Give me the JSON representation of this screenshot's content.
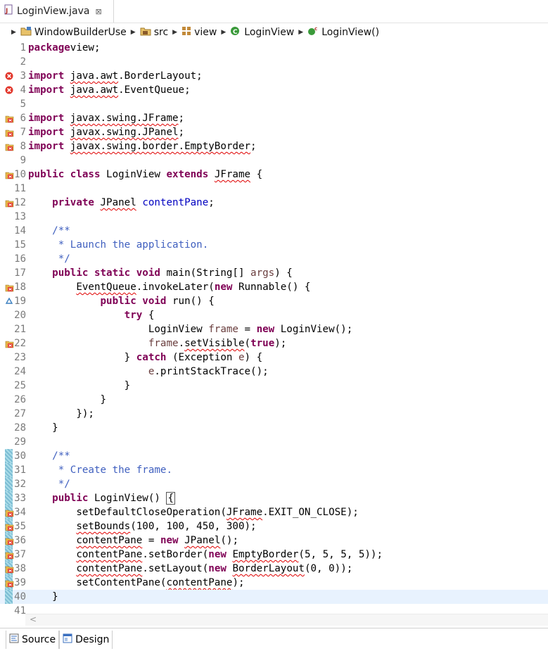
{
  "tab": {
    "file_name": "LoginView.java",
    "close_glyph": "⊠"
  },
  "breadcrumb": [
    {
      "label": "WindowBuilderUse",
      "icon": "project-icon"
    },
    {
      "label": "src",
      "icon": "source-folder-icon"
    },
    {
      "label": "view",
      "icon": "package-icon"
    },
    {
      "label": "LoginView",
      "icon": "class-icon"
    },
    {
      "label": "LoginView()",
      "icon": "constructor-icon"
    }
  ],
  "editor": {
    "lines": [
      {
        "n": "1",
        "marker": "",
        "code": [
          [
            "kw",
            "package"
          ],
          [
            "",
            "view;"
          ]
        ]
      },
      {
        "n": "2",
        "marker": "",
        "code": []
      },
      {
        "n": "3",
        "marker": "error",
        "code": [
          [
            "kw",
            "import"
          ],
          [
            "",
            " "
          ],
          [
            "err",
            "java.awt"
          ],
          [
            "",
            ".BorderLayout;"
          ]
        ]
      },
      {
        "n": "4",
        "marker": "error",
        "code": [
          [
            "kw",
            "import"
          ],
          [
            "",
            " "
          ],
          [
            "err",
            "java.awt"
          ],
          [
            "",
            ".EventQueue;"
          ]
        ]
      },
      {
        "n": "5",
        "marker": "",
        "code": []
      },
      {
        "n": "6",
        "marker": "fix",
        "code": [
          [
            "kw",
            "import"
          ],
          [
            "",
            " "
          ],
          [
            "err",
            "javax.swing.JFrame"
          ],
          [
            "",
            ";"
          ]
        ]
      },
      {
        "n": "7",
        "marker": "fix",
        "code": [
          [
            "kw",
            "import"
          ],
          [
            "",
            " "
          ],
          [
            "err",
            "javax.swing.JPanel"
          ],
          [
            "",
            ";"
          ]
        ]
      },
      {
        "n": "8",
        "marker": "fix",
        "code": [
          [
            "kw",
            "import"
          ],
          [
            "",
            " "
          ],
          [
            "err",
            "javax.swing.border.EmptyBorder"
          ],
          [
            "",
            ";"
          ]
        ]
      },
      {
        "n": "9",
        "marker": "",
        "code": []
      },
      {
        "n": "10",
        "marker": "fix",
        "code": [
          [
            "kw",
            "public class"
          ],
          [
            "",
            " LoginView "
          ],
          [
            "kw",
            "extends"
          ],
          [
            "",
            " "
          ],
          [
            "err",
            "JFrame"
          ],
          [
            "",
            " {"
          ]
        ]
      },
      {
        "n": "11",
        "marker": "",
        "code": []
      },
      {
        "n": "12",
        "marker": "fix",
        "code": [
          [
            "",
            "    "
          ],
          [
            "kw",
            "private"
          ],
          [
            "",
            " "
          ],
          [
            "err",
            "JPanel"
          ],
          [
            "",
            " "
          ],
          [
            "fld",
            "contentPane"
          ],
          [
            "",
            ";"
          ]
        ]
      },
      {
        "n": "13",
        "marker": "",
        "code": []
      },
      {
        "n": "14",
        "marker": "",
        "code": [
          [
            "cm",
            "    /**"
          ]
        ]
      },
      {
        "n": "15",
        "marker": "",
        "code": [
          [
            "cm",
            "     * Launch the application."
          ]
        ]
      },
      {
        "n": "16",
        "marker": "",
        "code": [
          [
            "cm",
            "     */"
          ]
        ]
      },
      {
        "n": "17",
        "marker": "",
        "code": [
          [
            "",
            "    "
          ],
          [
            "kw",
            "public static void"
          ],
          [
            "",
            " main(String[] "
          ],
          [
            "prm",
            "args"
          ],
          [
            "",
            ") {"
          ]
        ]
      },
      {
        "n": "18",
        "marker": "fix",
        "code": [
          [
            "",
            "        "
          ],
          [
            "err",
            "EventQueue"
          ],
          [
            "",
            ".invokeLater("
          ],
          [
            "kw",
            "new"
          ],
          [
            "",
            " Runnable() {"
          ]
        ]
      },
      {
        "n": "19",
        "marker": "override",
        "code": [
          [
            "",
            "            "
          ],
          [
            "kw",
            "public void"
          ],
          [
            "",
            " run() {"
          ]
        ]
      },
      {
        "n": "20",
        "marker": "",
        "code": [
          [
            "",
            "                "
          ],
          [
            "kw",
            "try"
          ],
          [
            "",
            " {"
          ]
        ]
      },
      {
        "n": "21",
        "marker": "",
        "code": [
          [
            "",
            "                    LoginView "
          ],
          [
            "prm",
            "frame"
          ],
          [
            "",
            " = "
          ],
          [
            "kw",
            "new"
          ],
          [
            "",
            " LoginView();"
          ]
        ]
      },
      {
        "n": "22",
        "marker": "fix",
        "code": [
          [
            "",
            "                    "
          ],
          [
            "prm",
            "frame"
          ],
          [
            "",
            "."
          ],
          [
            "err",
            "setVisible"
          ],
          [
            "",
            "("
          ],
          [
            "kw",
            "true"
          ],
          [
            "",
            ");"
          ]
        ]
      },
      {
        "n": "23",
        "marker": "",
        "code": [
          [
            "",
            "                } "
          ],
          [
            "kw",
            "catch"
          ],
          [
            "",
            " (Exception "
          ],
          [
            "prm",
            "e"
          ],
          [
            "",
            ") {"
          ]
        ]
      },
      {
        "n": "24",
        "marker": "",
        "code": [
          [
            "",
            "                    "
          ],
          [
            "prm",
            "e"
          ],
          [
            "",
            ".printStackTrace();"
          ]
        ]
      },
      {
        "n": "25",
        "marker": "",
        "code": [
          [
            "",
            "                }"
          ]
        ]
      },
      {
        "n": "26",
        "marker": "",
        "code": [
          [
            "",
            "            }"
          ]
        ]
      },
      {
        "n": "27",
        "marker": "",
        "code": [
          [
            "",
            "        });"
          ]
        ]
      },
      {
        "n": "28",
        "marker": "",
        "code": [
          [
            "",
            "    }"
          ]
        ]
      },
      {
        "n": "29",
        "marker": "",
        "code": []
      },
      {
        "n": "30",
        "marker": "bar",
        "code": [
          [
            "cm",
            "    /**"
          ]
        ]
      },
      {
        "n": "31",
        "marker": "bar",
        "code": [
          [
            "cm",
            "     * Create the frame."
          ]
        ]
      },
      {
        "n": "32",
        "marker": "bar",
        "code": [
          [
            "cm",
            "     */"
          ]
        ]
      },
      {
        "n": "33",
        "marker": "bar",
        "code": [
          [
            "",
            "    "
          ],
          [
            "kw",
            "public"
          ],
          [
            "",
            " LoginView() "
          ],
          [
            "caret",
            "{"
          ]
        ]
      },
      {
        "n": "34",
        "marker": "barfix",
        "code": [
          [
            "",
            "        setDefaultCloseOperation("
          ],
          [
            "err",
            "JFrame"
          ],
          [
            "",
            ".EXIT_ON_CLOSE);"
          ]
        ]
      },
      {
        "n": "35",
        "marker": "barfix",
        "code": [
          [
            "",
            "        "
          ],
          [
            "err",
            "setBounds"
          ],
          [
            "",
            "(100, 100, 450, 300);"
          ]
        ]
      },
      {
        "n": "36",
        "marker": "barfix",
        "code": [
          [
            "",
            "        "
          ],
          [
            "err",
            "contentPane"
          ],
          [
            "",
            " = "
          ],
          [
            "kw",
            "new"
          ],
          [
            "",
            " "
          ],
          [
            "err",
            "JPanel"
          ],
          [
            "",
            "();"
          ]
        ]
      },
      {
        "n": "37",
        "marker": "barfix",
        "code": [
          [
            "",
            "        "
          ],
          [
            "err",
            "contentPane"
          ],
          [
            "",
            ".setBorder("
          ],
          [
            "kw",
            "new"
          ],
          [
            "",
            " "
          ],
          [
            "err",
            "EmptyBorder"
          ],
          [
            "",
            "(5, 5, 5, 5));"
          ]
        ]
      },
      {
        "n": "38",
        "marker": "barfix",
        "code": [
          [
            "",
            "        "
          ],
          [
            "err",
            "contentPane"
          ],
          [
            "",
            ".setLayout("
          ],
          [
            "kw",
            "new"
          ],
          [
            "",
            " "
          ],
          [
            "err",
            "BorderLayout"
          ],
          [
            "",
            "(0, 0));"
          ]
        ]
      },
      {
        "n": "39",
        "marker": "barfix",
        "code": [
          [
            "",
            "        setContentPane("
          ],
          [
            "err",
            "contentPane"
          ],
          [
            "",
            ");"
          ]
        ]
      },
      {
        "n": "40",
        "marker": "barcur",
        "code": [
          [
            "",
            "    }"
          ]
        ]
      },
      {
        "n": "41",
        "marker": "",
        "code": []
      }
    ]
  },
  "scrollbar": {
    "left_arrow": "<"
  },
  "bottom_tabs": [
    {
      "label": "Source",
      "icon": "source-tab-icon"
    },
    {
      "label": "Design",
      "icon": "design-tab-icon"
    }
  ]
}
